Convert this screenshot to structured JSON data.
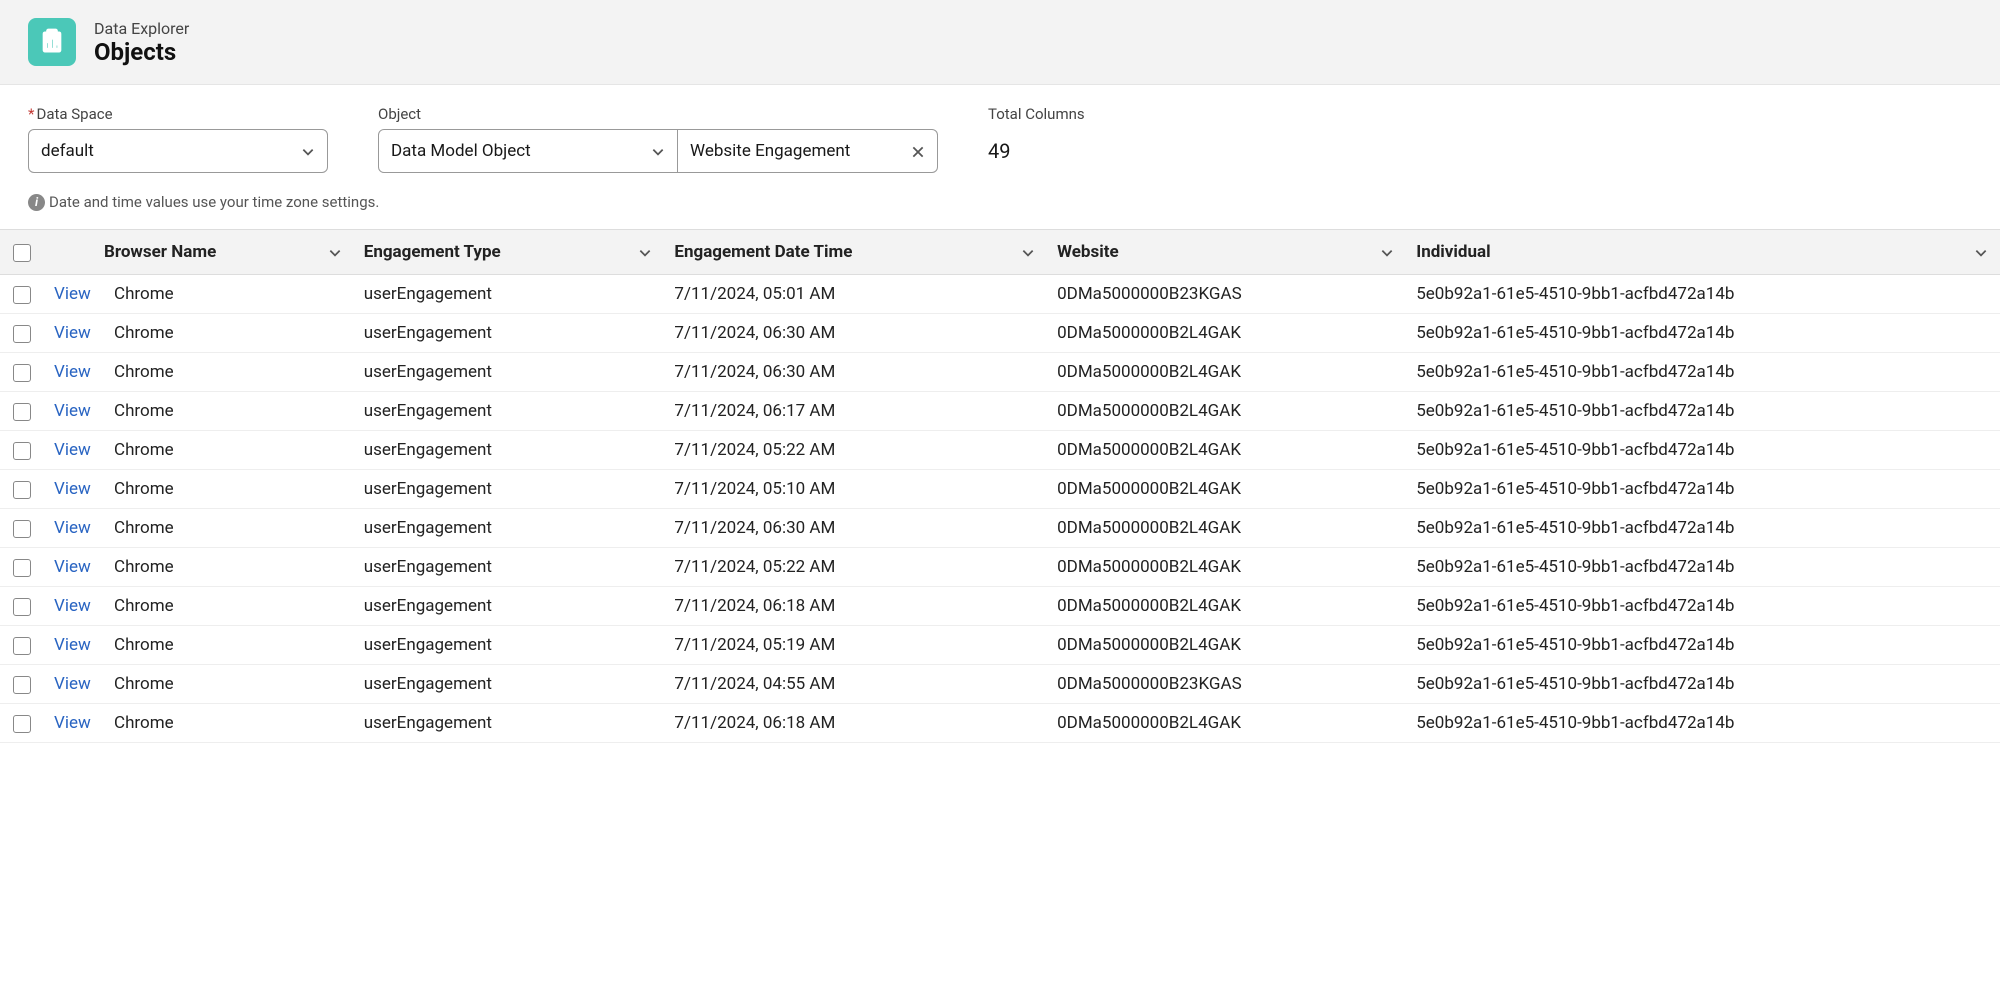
{
  "header": {
    "super": "Data Explorer",
    "title": "Objects"
  },
  "controls": {
    "dataSpace": {
      "label": "Data Space",
      "value": "default",
      "required": true
    },
    "object": {
      "label": "Object",
      "value": "Data Model Object",
      "selection": "Website Engagement"
    },
    "totalColumns": {
      "label": "Total Columns",
      "value": "49"
    }
  },
  "infoNote": "Date and time values use your time zone settings.",
  "columns": {
    "browser": "Browser Name",
    "engagementType": "Engagement Type",
    "engagementDateTime": "Engagement Date Time",
    "website": "Website",
    "individual": "Individual"
  },
  "viewLabel": "View",
  "rows": [
    {
      "browser": "Chrome",
      "engagementType": "userEngagement",
      "dateTime": "7/11/2024, 05:01 AM",
      "website": "0DMa5000000B23KGAS",
      "individual": "5e0b92a1-61e5-4510-9bb1-acfbd472a14b"
    },
    {
      "browser": "Chrome",
      "engagementType": "userEngagement",
      "dateTime": "7/11/2024, 06:30 AM",
      "website": "0DMa5000000B2L4GAK",
      "individual": "5e0b92a1-61e5-4510-9bb1-acfbd472a14b"
    },
    {
      "browser": "Chrome",
      "engagementType": "userEngagement",
      "dateTime": "7/11/2024, 06:30 AM",
      "website": "0DMa5000000B2L4GAK",
      "individual": "5e0b92a1-61e5-4510-9bb1-acfbd472a14b"
    },
    {
      "browser": "Chrome",
      "engagementType": "userEngagement",
      "dateTime": "7/11/2024, 06:17 AM",
      "website": "0DMa5000000B2L4GAK",
      "individual": "5e0b92a1-61e5-4510-9bb1-acfbd472a14b"
    },
    {
      "browser": "Chrome",
      "engagementType": "userEngagement",
      "dateTime": "7/11/2024, 05:22 AM",
      "website": "0DMa5000000B2L4GAK",
      "individual": "5e0b92a1-61e5-4510-9bb1-acfbd472a14b"
    },
    {
      "browser": "Chrome",
      "engagementType": "userEngagement",
      "dateTime": "7/11/2024, 05:10 AM",
      "website": "0DMa5000000B2L4GAK",
      "individual": "5e0b92a1-61e5-4510-9bb1-acfbd472a14b"
    },
    {
      "browser": "Chrome",
      "engagementType": "userEngagement",
      "dateTime": "7/11/2024, 06:30 AM",
      "website": "0DMa5000000B2L4GAK",
      "individual": "5e0b92a1-61e5-4510-9bb1-acfbd472a14b"
    },
    {
      "browser": "Chrome",
      "engagementType": "userEngagement",
      "dateTime": "7/11/2024, 05:22 AM",
      "website": "0DMa5000000B2L4GAK",
      "individual": "5e0b92a1-61e5-4510-9bb1-acfbd472a14b"
    },
    {
      "browser": "Chrome",
      "engagementType": "userEngagement",
      "dateTime": "7/11/2024, 06:18 AM",
      "website": "0DMa5000000B2L4GAK",
      "individual": "5e0b92a1-61e5-4510-9bb1-acfbd472a14b"
    },
    {
      "browser": "Chrome",
      "engagementType": "userEngagement",
      "dateTime": "7/11/2024, 05:19 AM",
      "website": "0DMa5000000B2L4GAK",
      "individual": "5e0b92a1-61e5-4510-9bb1-acfbd472a14b"
    },
    {
      "browser": "Chrome",
      "engagementType": "userEngagement",
      "dateTime": "7/11/2024, 04:55 AM",
      "website": "0DMa5000000B23KGAS",
      "individual": "5e0b92a1-61e5-4510-9bb1-acfbd472a14b"
    },
    {
      "browser": "Chrome",
      "engagementType": "userEngagement",
      "dateTime": "7/11/2024, 06:18 AM",
      "website": "0DMa5000000B2L4GAK",
      "individual": "5e0b92a1-61e5-4510-9bb1-acfbd472a14b"
    }
  ]
}
